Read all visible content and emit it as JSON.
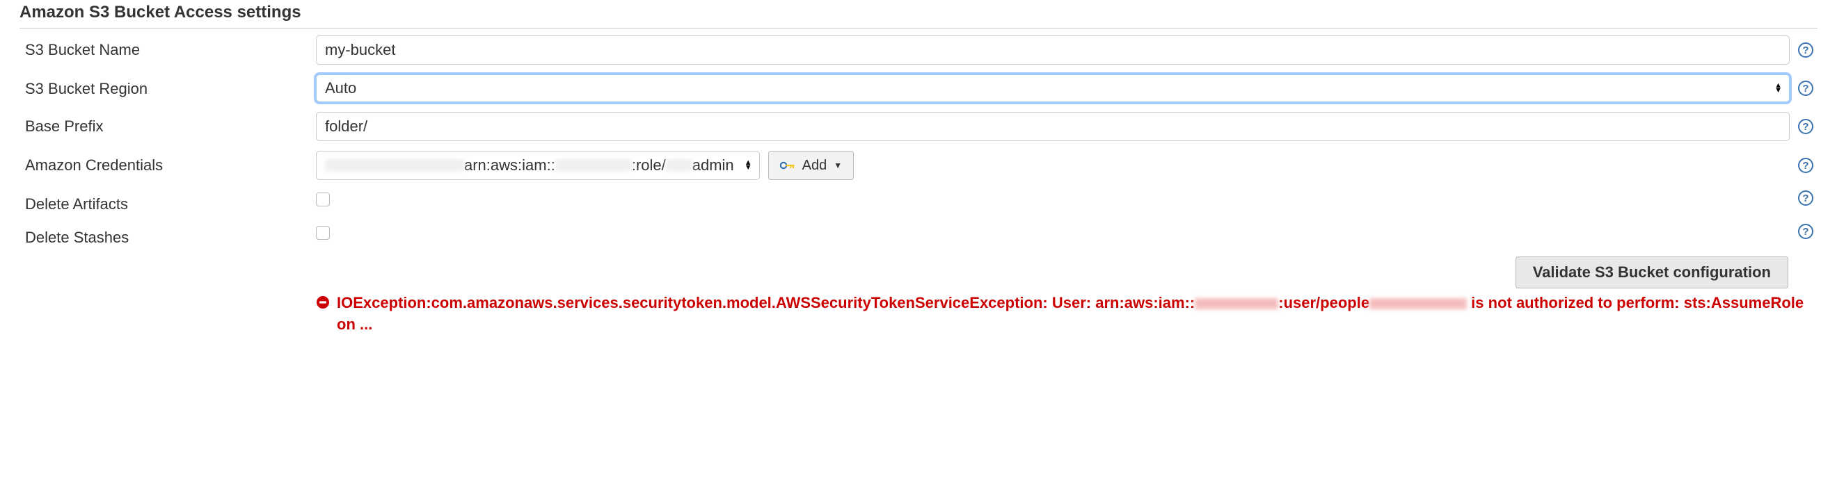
{
  "section": {
    "title": "Amazon S3 Bucket Access settings"
  },
  "labels": {
    "bucket_name": "S3 Bucket Name",
    "bucket_region": "S3 Bucket Region",
    "base_prefix": "Base Prefix",
    "credentials": "Amazon Credentials",
    "delete_artifacts": "Delete Artifacts",
    "delete_stashes": "Delete Stashes"
  },
  "values": {
    "bucket_name": "my-bucket",
    "bucket_region": "Auto",
    "base_prefix": "folder/",
    "credentials_pre": "arn:aws:iam::",
    "credentials_mid": ":role/",
    "credentials_suf": "admin",
    "delete_artifacts": false,
    "delete_stashes": false
  },
  "buttons": {
    "add": "Add",
    "validate": "Validate S3 Bucket configuration"
  },
  "error": {
    "part1": "IOException:com.amazonaws.services.securitytoken.model.AWSSecurityTokenServiceException: User: arn:aws:iam::",
    "part2": ":user/people",
    "part3": " is not authorized to perform: sts:AssumeRole on ..."
  }
}
